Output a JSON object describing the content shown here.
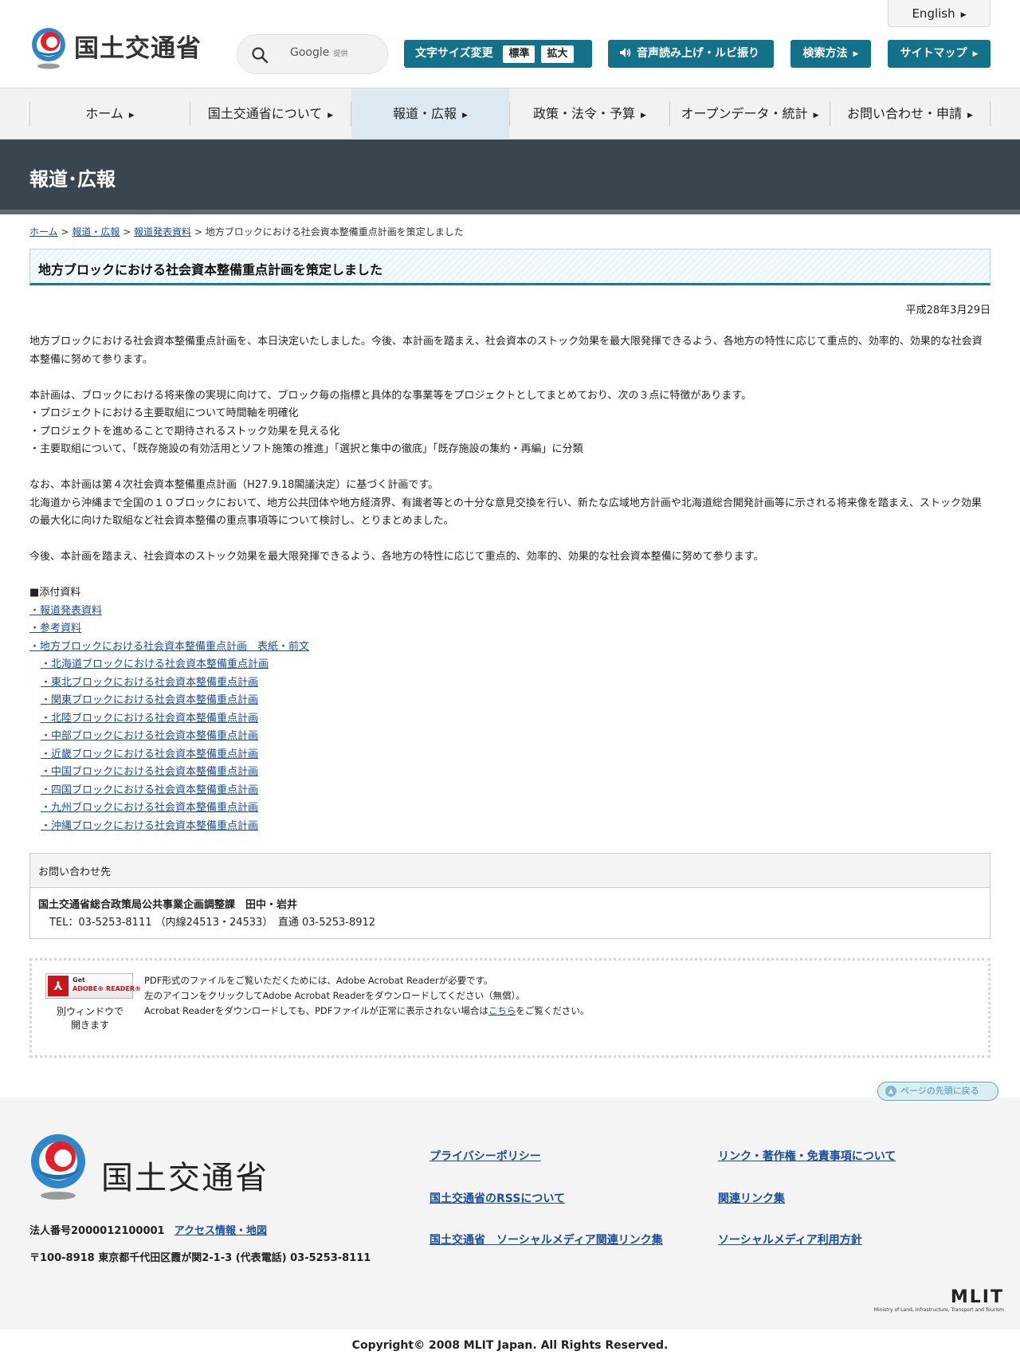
{
  "header": {
    "logo_text": "国土交通省",
    "search_placeholder": "Google",
    "search_provided": "提供",
    "english": "English",
    "fontsize_label": "文字サイズ変更",
    "fontsize_standard": "標準",
    "fontsize_large": "拡大",
    "voice": "音声読み上げ・ルビ振り",
    "search_method": "検索方法",
    "sitemap": "サイトマップ"
  },
  "gnav": [
    {
      "label": "ホーム"
    },
    {
      "label": "国土交通省について"
    },
    {
      "label": "報道・広報"
    },
    {
      "label": "政策・法令・予算"
    },
    {
      "label": "オープンデータ・統計"
    },
    {
      "label": "お問い合わせ・申請"
    }
  ],
  "band_title": "報道･広報",
  "breadcrumb": {
    "home": "ホーム",
    "sep": " > ",
    "koho": "報道・広報",
    "release": "報道発表資料",
    "current": "地方ブロックにおける社会資本整備重点計画を策定しました"
  },
  "article": {
    "title": "地方ブロックにおける社会資本整備重点計画を策定しました",
    "date": "平成28年3月29日",
    "p1": "地方ブロックにおける社会資本整備重点計画を、本日決定いたしました。今後、本計画を踏まえ、社会資本のストック効果を最大限発揮できるよう、各地方の特性に応じて重点的、効率的、効果的な社会資本整備に努めて参ります。",
    "p2": "本計画は、ブロックにおける将来像の実現に向けて、ブロック毎の指標と具体的な事業等をプロジェクトとしてまとめており、次の３点に特徴があります。",
    "p2_items": [
      "・プロジェクトにおける主要取組について時間軸を明確化",
      "・プロジェクトを進めることで期待されるストック効果を見える化",
      "・主要取組について、「既存施設の有効活用とソフト施策の推進」「選択と集中の徹底」「既存施設の集約・再編」に分類"
    ],
    "p3a": "なお、本計画は第４次社会資本整備重点計画（H27.9.18閣議決定）に基づく計画です。",
    "p3b": "北海道から沖縄まで全国の１０ブロックにおいて、地方公共団体や地方経済界、有識者等との十分な意見交換を行い、新たな広域地方計画や北海道総合開発計画等に示される将来像を踏まえ、ストック効果の最大化に向けた取組など社会資本整備の重点事項等について検討し、とりまとめました。",
    "p4": "今後、本計画を踏まえ、社会資本のストック効果を最大限発揮できるよう、各地方の特性に応じて重点的、効率的、効果的な社会資本整備に努めて参ります。",
    "attach_heading": "■添付資料",
    "attachments": [
      "・報道発表資料",
      "・参考資料",
      "・地方ブロックにおける社会資本整備重点計画　表紙・前文"
    ],
    "block_attachments": [
      "・北海道ブロックにおける社会資本整備重点計画",
      "・東北ブロックにおける社会資本整備重点計画",
      "・関東ブロックにおける社会資本整備重点計画",
      "・北陸ブロックにおける社会資本整備重点計画",
      "・中部ブロックにおける社会資本整備重点計画",
      "・近畿ブロックにおける社会資本整備重点計画",
      "・中国ブロックにおける社会資本整備重点計画",
      "・四国ブロックにおける社会資本整備重点計画",
      "・九州ブロックにおける社会資本整備重点計画",
      "・沖縄ブロックにおける社会資本整備重点計画"
    ]
  },
  "contact": {
    "heading": "お問い合わせ先",
    "org": "国土交通省総合政策局公共事業企画調整課　田中・岩井",
    "tel": "TEL：03-5253-8111 （内線24513・24533）　直通 03-5253-8912"
  },
  "adobe": {
    "icon_get": "Get",
    "icon_reader": "ADOBE® READER®",
    "caption_line1": "別ウィンドウで",
    "caption_line2": "開きます",
    "line1": "PDF形式のファイルをご覧いただくためには、Adobe Acrobat Readerが必要です。",
    "line2": "左のアイコンをクリックしてAdobe Acrobat Readerをダウンロードしてください（無償）。",
    "line3_pre": "Acrobat Readerをダウンロードしても、PDFファイルが正常に表示されない場合は",
    "line3_link": "こちら",
    "line3_post": "をご覧ください。"
  },
  "footer": {
    "pagetop": "ページの先頭に戻る",
    "logo_text": "国土交通省",
    "corp_number": "法人番号2000012100001",
    "access": "アクセス情報・地図",
    "address": "〒100-8918 東京都千代田区霞が関2-1-3 (代表電話) 03-5253-8111",
    "links": {
      "privacy": "プライバシーポリシー",
      "copyright_terms": "リンク・著作権・免責事項について",
      "rss": "国土交通省のRSSについて",
      "related": "関連リンク集",
      "social_links": "国土交通省　ソーシャルメディア関連リンク集",
      "social_policy": "ソーシャルメディア利用方針"
    },
    "mlit": "MLIT",
    "mlit_sub": "Ministry of Land, Infrastructure, Transport and Tourism",
    "copyright": "Copyright© 2008 MLIT Japan. All Rights Reserved."
  },
  "colors": {
    "teal": "#13718a",
    "band": "#39464f",
    "link": "#1a4d9c"
  }
}
